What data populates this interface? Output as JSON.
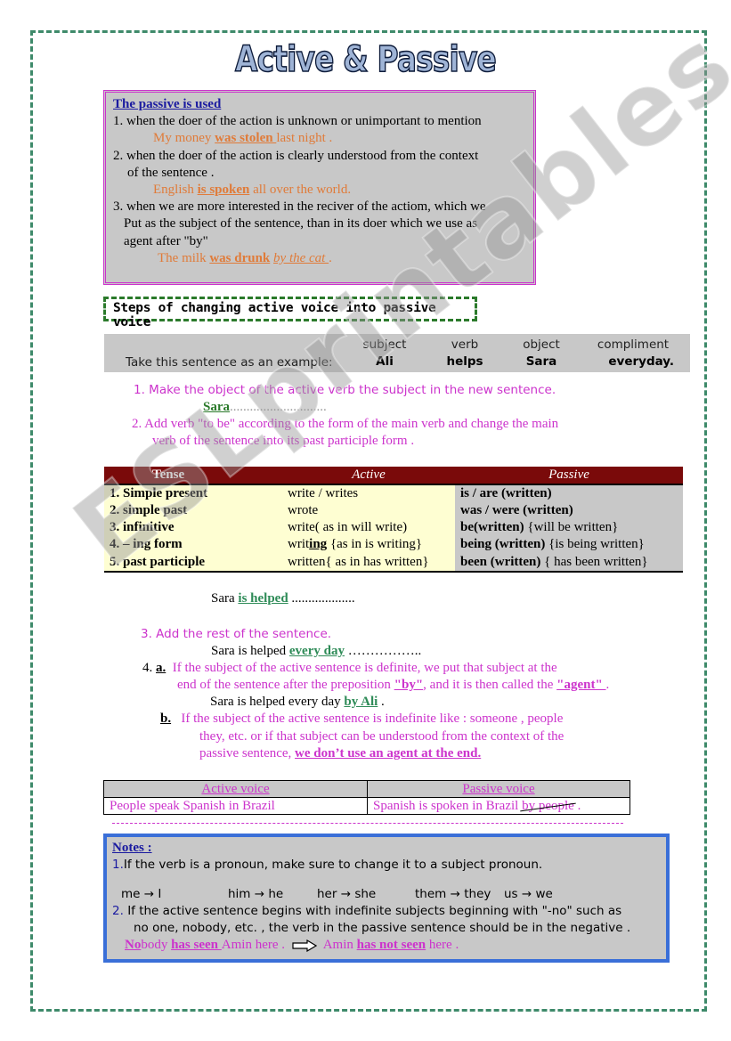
{
  "title": "Active & Passive",
  "watermark": "ESLprintables.com",
  "usage": {
    "heading": "The passive is used",
    "items": [
      {
        "text": "1. when the doer of the action is unknown or unimportant to mention",
        "example": {
          "pre": "My money ",
          "verb": "was stolen ",
          "post": "last night ."
        }
      },
      {
        "text": "2. when the  doer of the action is clearly understood from the context",
        "text2": "of  the sentence .",
        "example": {
          "pre": "English ",
          "verb": "is spoken",
          "post": " all over the world."
        }
      },
      {
        "text": "3. when we are more interested in the reciver of the actiom, which we",
        "text2": "Put as the subject of the sentence, than in its doer which we use as",
        "text3": "agent after \"by\"",
        "example": {
          "pre": "The milk ",
          "verb": "was drunk",
          "agent": "by the cat ",
          "post": "."
        }
      }
    ]
  },
  "steps": {
    "heading": "Steps of changing active voice into passive voice",
    "example": {
      "label": "Take this sentence as an example:",
      "columns": [
        {
          "header": "subject",
          "value": "Ali"
        },
        {
          "header": "verb",
          "value": "helps"
        },
        {
          "header": "object",
          "value": "Sara"
        },
        {
          "header": "compliment",
          "value": "everyday."
        }
      ]
    },
    "step1": "1. Make the object of the active verb the subject in the new sentence.",
    "step1_example": {
      "word": "Sara",
      "dots": "............................."
    },
    "step2_line1": "2.  Add verb \"to be\" according to the form of the main verb and change the main",
    "step2_line2": "verb of the sentence into its past participle form .",
    "tense_table": {
      "headers": [
        "Tense",
        "Active",
        "Passive"
      ],
      "rows": [
        {
          "tense": "1. Simple present",
          "active": "write  / writes",
          "active_u": "",
          "active_post": "",
          "passive_b": "is / are (written)",
          "passive": ""
        },
        {
          "tense": "2. simple past",
          "active": "wrote",
          "active_u": "",
          "active_post": "",
          "passive_b": "was / were (written)",
          "passive": ""
        },
        {
          "tense": "3. infinitive",
          "active": "write( as in will write)",
          "active_u": "",
          "active_post": "",
          "passive_b": "be(written)",
          "passive": " {will be written}"
        },
        {
          "tense": "4. – ing form",
          "active": "writ",
          "active_u": "ing",
          "active_post": " {as in is writing}",
          "passive_b": "being (written)",
          "passive": " {is being written}"
        },
        {
          "tense": "5. past participle",
          "active": "written{ as in has written}",
          "active_u": "",
          "active_post": "",
          "passive_b": "been (written)",
          "passive": " { has been written}"
        }
      ]
    },
    "step2_example": {
      "pre": "Sara ",
      "verb": "is helped",
      "dots": " ..................."
    },
    "step3": "3. Add the rest of the sentence.",
    "step3_example": {
      "pre": "Sara is helped ",
      "rest": "every day",
      "dots": " …………….."
    },
    "step4": {
      "num": "4.",
      "a_label": "a.",
      "a_line1": "If the subject of the active sentence is definite, we put that subject at the",
      "a_line2_pre": "end of the sentence after the preposition ",
      "a_by": "\"by\"",
      "a_line2_mid": ", and it is then called the ",
      "a_agent": "\"agent\" ",
      "a_line2_post": ".",
      "a_example": {
        "pre": "Sara is helped every day ",
        "agent": "by Ali",
        "post": " ."
      },
      "b_label": "b.",
      "b_line1": "If  the subject of the active sentence is indefinite like : someone , people",
      "b_line2": "they, etc. or if that subject can be understood from the context of the",
      "b_line3_pre": "passive sentence, ",
      "b_line3_u": "we don’t use an agent at the end."
    }
  },
  "voice_table": {
    "headers": [
      "Active voice",
      "Passive voice"
    ],
    "active": "People speak Spanish in Brazil",
    "passive_pre": "Spanish is spoken in Brazil ",
    "passive_struck": "by people",
    "passive_post": " ."
  },
  "notes": {
    "heading": "Notes :",
    "n1_num": "1.",
    "n1": "If the verb is a pronoun, make sure to change it to a subject pronoun.",
    "pronouns": [
      {
        "from": "me",
        "to": "I"
      },
      {
        "from": "him",
        "to": "he"
      },
      {
        "from": "her",
        "to": "she"
      },
      {
        "from": "them",
        "to": "they"
      },
      {
        "from": "us",
        "to": "we"
      }
    ],
    "arrow": "→",
    "n2_num": "2.",
    "n2_line1": "If the active sentence begins with indefinite subjects beginning with \"-no\"  such as",
    "n2_line2": "no one, nobody, etc. , the verb in the passive sentence should be in the negative .",
    "example": {
      "no": "No",
      "body": "body ",
      "verb": "has seen ",
      "rest": "Amin here .",
      "res_pre": "Amin ",
      "res_verb": "has not seen",
      "res_post": " here ."
    }
  }
}
